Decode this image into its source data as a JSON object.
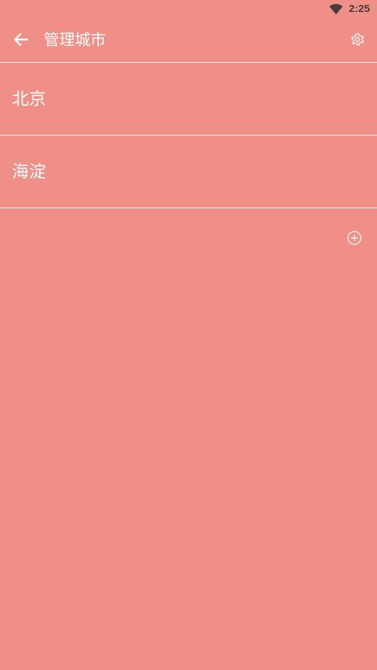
{
  "status_bar": {
    "time": "2:25",
    "wifi_icon": "wifi-icon"
  },
  "toolbar": {
    "back_icon": "arrow-left-icon",
    "title": "管理城市",
    "settings_icon": "gear-icon"
  },
  "cities": [
    {
      "name": "北京"
    },
    {
      "name": "海淀"
    }
  ],
  "add_icon": "plus-circle-icon",
  "colors": {
    "background": "#F08F87",
    "foreground": "#FFFFFF",
    "status_text": "#4A3A38"
  }
}
